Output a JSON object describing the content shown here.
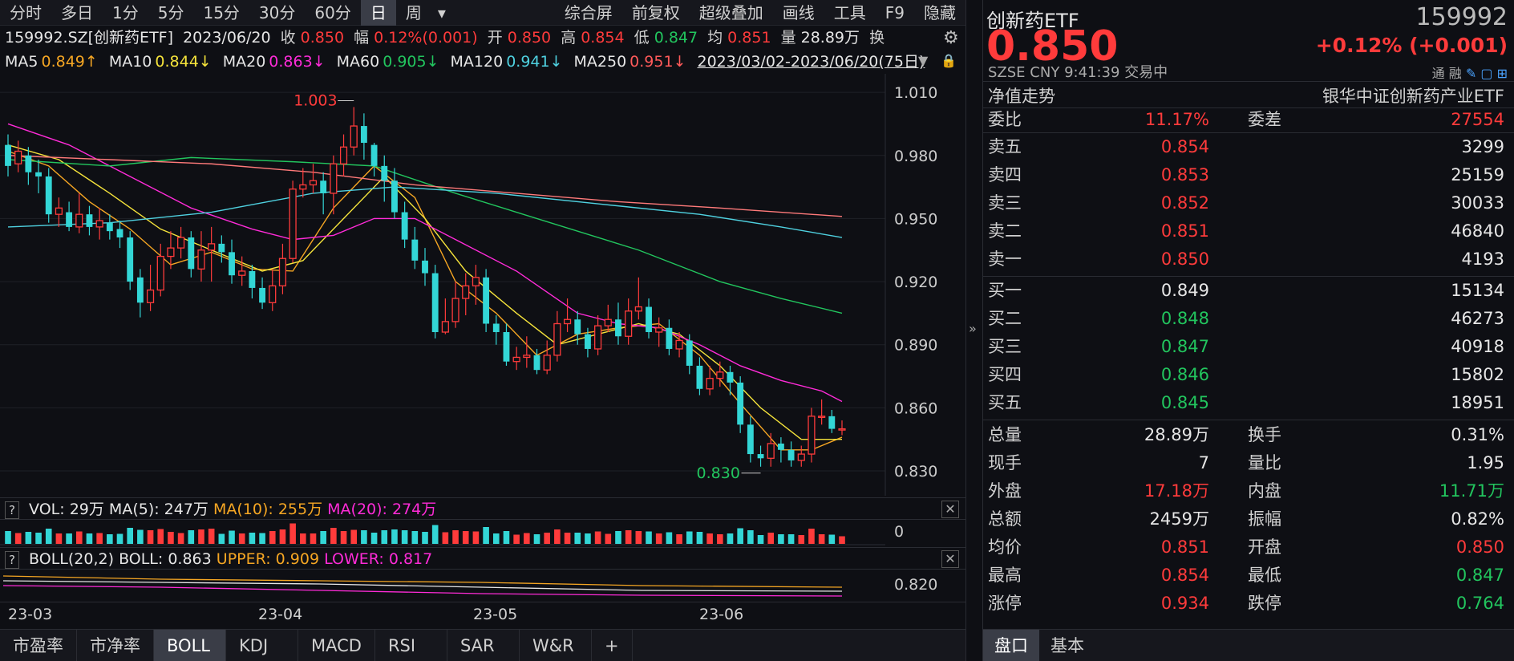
{
  "toolbar": {
    "left_items": [
      "分时",
      "多日",
      "1分",
      "5分",
      "15分",
      "30分",
      "60分",
      "日",
      "周"
    ],
    "active_index": 7,
    "dropdown_glyph": "▾",
    "right_items": [
      "综合屏",
      "前复权",
      "超级叠加",
      "画线",
      "工具",
      "F9",
      "隐藏"
    ]
  },
  "info": {
    "code": "159992.SZ[创新药ETF]",
    "date": "2023/06/20",
    "close_label": "收",
    "close": "0.850",
    "change_label": "幅",
    "change": "0.12%(0.001)",
    "open_label": "开",
    "open": "0.850",
    "high_label": "高",
    "high": "0.854",
    "low_label": "低",
    "low": "0.847",
    "avg_label": "均",
    "avg": "0.851",
    "volume_label": "量",
    "volume": "28.89万",
    "turnover_label": "换"
  },
  "ma": {
    "items": [
      {
        "label": "MA5",
        "value": "0.849↑",
        "color": "#f5a623"
      },
      {
        "label": "MA10",
        "value": "0.844↓",
        "color": "#f5e33b"
      },
      {
        "label": "MA20",
        "value": "0.863↓",
        "color": "#ff2bd8"
      },
      {
        "label": "MA60",
        "value": "0.905↓",
        "color": "#22c55e"
      },
      {
        "label": "MA120",
        "value": "0.941↓",
        "color": "#4fd1e0"
      },
      {
        "label": "MA250",
        "value": "0.951↓",
        "color": "#ff5a5a"
      }
    ],
    "range": "2023/03/02-2023/06/20(75日)"
  },
  "chart": {
    "y_ticks": [
      "1.010",
      "0.980",
      "0.950",
      "0.920",
      "0.890",
      "0.860",
      "0.830"
    ],
    "max_label": "1.003",
    "min_label": "0.830",
    "x_ticks": [
      "23-03",
      "23-04",
      "23-05",
      "23-06"
    ]
  },
  "vol": {
    "title": "VOL: 29万",
    "ma5": "MA(5): 247万",
    "ma10": "MA(10): 255万",
    "ma20": "MA(20): 274万",
    "axis": "0"
  },
  "boll": {
    "title": "BOLL(20,2)",
    "boll": "BOLL: 0.863",
    "upper": "UPPER: 0.909",
    "lower": "LOWER: 0.817",
    "axis": "0.820"
  },
  "bottom_tabs": [
    "市盈率",
    "市净率",
    "BOLL",
    "KDJ",
    "MACD",
    "RSI",
    "SAR",
    "W&R",
    "+"
  ],
  "bottom_active": 2,
  "quote": {
    "name": "创新药ETF",
    "code": "159992",
    "price": "0.850",
    "change": "+0.12% (+0.001)",
    "exchange": "SZSE",
    "currency": "CNY",
    "time": "9:41:39",
    "status": "交易中",
    "icon_labels": [
      "通",
      "融"
    ],
    "nav_label": "净值走势",
    "index_name": "银华中证创新药产业ETF",
    "weibi_label": "委比",
    "weibi": "11.17%",
    "weicha_label": "委差",
    "weicha": "27554",
    "asks": [
      {
        "label": "卖五",
        "price": "0.854",
        "vol": "3299"
      },
      {
        "label": "卖四",
        "price": "0.853",
        "vol": "25159"
      },
      {
        "label": "卖三",
        "price": "0.852",
        "vol": "30033"
      },
      {
        "label": "卖二",
        "price": "0.851",
        "vol": "46840"
      },
      {
        "label": "卖一",
        "price": "0.850",
        "vol": "4193"
      }
    ],
    "bids": [
      {
        "label": "买一",
        "price": "0.849",
        "vol": "15134"
      },
      {
        "label": "买二",
        "price": "0.848",
        "vol": "46273"
      },
      {
        "label": "买三",
        "price": "0.847",
        "vol": "40918"
      },
      {
        "label": "买四",
        "price": "0.846",
        "vol": "15802"
      },
      {
        "label": "买五",
        "price": "0.845",
        "vol": "18951"
      }
    ],
    "stats": [
      {
        "l1": "总量",
        "v1": "28.89万",
        "l2": "换手",
        "v2": "0.31%"
      },
      {
        "l1": "现手",
        "v1": "7",
        "l2": "量比",
        "v2": "1.95"
      },
      {
        "l1": "外盘",
        "v1": "17.18万",
        "l2": "内盘",
        "v2": "11.71万"
      },
      {
        "l1": "总额",
        "v1": "2459万",
        "l2": "振幅",
        "v2": "0.82%"
      },
      {
        "l1": "均价",
        "v1": "0.851",
        "l2": "开盘",
        "v2": "0.850"
      },
      {
        "l1": "最高",
        "v1": "0.854",
        "l2": "最低",
        "v2": "0.847"
      },
      {
        "l1": "涨停",
        "v1": "0.934",
        "l2": "跌停",
        "v2": "0.764"
      }
    ],
    "tabs": [
      "盘口",
      "基本"
    ]
  },
  "chart_data": {
    "type": "candlestick",
    "ylim": [
      0.822,
      1.015
    ],
    "candles": [
      [
        0.985,
        0.975,
        0.99,
        0.97
      ],
      [
        0.976,
        0.982,
        0.987,
        0.972
      ],
      [
        0.98,
        0.972,
        0.984,
        0.966
      ],
      [
        0.972,
        0.97,
        0.978,
        0.962
      ],
      [
        0.97,
        0.952,
        0.974,
        0.948
      ],
      [
        0.952,
        0.955,
        0.96,
        0.946
      ],
      [
        0.953,
        0.946,
        0.958,
        0.944
      ],
      [
        0.946,
        0.952,
        0.962,
        0.943
      ],
      [
        0.952,
        0.946,
        0.956,
        0.942
      ],
      [
        0.946,
        0.949,
        0.955,
        0.94
      ],
      [
        0.948,
        0.944,
        0.952,
        0.94
      ],
      [
        0.945,
        0.941,
        0.949,
        0.936
      ],
      [
        0.941,
        0.92,
        0.944,
        0.916
      ],
      [
        0.922,
        0.91,
        0.926,
        0.903
      ],
      [
        0.91,
        0.916,
        0.928,
        0.906
      ],
      [
        0.916,
        0.932,
        0.938,
        0.913
      ],
      [
        0.932,
        0.936,
        0.944,
        0.926
      ],
      [
        0.936,
        0.941,
        0.946,
        0.931
      ],
      [
        0.941,
        0.926,
        0.944,
        0.922
      ],
      [
        0.926,
        0.935,
        0.944,
        0.92
      ],
      [
        0.935,
        0.938,
        0.946,
        0.92
      ],
      [
        0.938,
        0.934,
        0.942,
        0.929
      ],
      [
        0.934,
        0.923,
        0.94,
        0.919
      ],
      [
        0.923,
        0.925,
        0.932,
        0.918
      ],
      [
        0.925,
        0.917,
        0.928,
        0.912
      ],
      [
        0.917,
        0.91,
        0.922,
        0.907
      ],
      [
        0.91,
        0.918,
        0.926,
        0.906
      ],
      [
        0.918,
        0.931,
        0.938,
        0.914
      ],
      [
        0.931,
        0.964,
        0.968,
        0.929
      ],
      [
        0.964,
        0.966,
        0.974,
        0.96
      ],
      [
        0.966,
        0.968,
        0.976,
        0.962
      ],
      [
        0.968,
        0.962,
        0.972,
        0.952
      ],
      [
        0.962,
        0.976,
        0.98,
        0.952
      ],
      [
        0.976,
        0.984,
        0.99,
        0.97
      ],
      [
        0.984,
        0.994,
        1.003,
        0.98
      ],
      [
        0.994,
        0.986,
        1.0,
        0.978
      ],
      [
        0.985,
        0.975,
        0.986,
        0.97
      ],
      [
        0.975,
        0.968,
        0.98,
        0.958
      ],
      [
        0.968,
        0.953,
        0.974,
        0.95
      ],
      [
        0.953,
        0.94,
        0.958,
        0.936
      ],
      [
        0.94,
        0.93,
        0.946,
        0.926
      ],
      [
        0.93,
        0.924,
        0.936,
        0.918
      ],
      [
        0.924,
        0.896,
        0.928,
        0.893
      ],
      [
        0.896,
        0.901,
        0.912,
        0.895
      ],
      [
        0.901,
        0.912,
        0.92,
        0.898
      ],
      [
        0.912,
        0.918,
        0.924,
        0.904
      ],
      [
        0.918,
        0.922,
        0.928,
        0.909
      ],
      [
        0.922,
        0.9,
        0.926,
        0.896
      ],
      [
        0.9,
        0.896,
        0.904,
        0.89
      ],
      [
        0.896,
        0.882,
        0.9,
        0.88
      ],
      [
        0.882,
        0.884,
        0.889,
        0.878
      ],
      [
        0.884,
        0.885,
        0.894,
        0.879
      ],
      [
        0.885,
        0.878,
        0.888,
        0.876
      ],
      [
        0.878,
        0.885,
        0.892,
        0.876
      ],
      [
        0.885,
        0.9,
        0.906,
        0.882
      ],
      [
        0.9,
        0.902,
        0.912,
        0.896
      ],
      [
        0.902,
        0.895,
        0.906,
        0.89
      ],
      [
        0.895,
        0.888,
        0.898,
        0.884
      ],
      [
        0.888,
        0.899,
        0.904,
        0.885
      ],
      [
        0.899,
        0.902,
        0.909,
        0.896
      ],
      [
        0.902,
        0.894,
        0.91,
        0.89
      ],
      [
        0.894,
        0.906,
        0.912,
        0.89
      ],
      [
        0.906,
        0.908,
        0.922,
        0.902
      ],
      [
        0.908,
        0.896,
        0.912,
        0.893
      ],
      [
        0.896,
        0.898,
        0.903,
        0.889
      ],
      [
        0.898,
        0.888,
        0.902,
        0.885
      ],
      [
        0.888,
        0.892,
        0.896,
        0.884
      ],
      [
        0.892,
        0.88,
        0.895,
        0.876
      ],
      [
        0.88,
        0.869,
        0.884,
        0.866
      ],
      [
        0.869,
        0.874,
        0.88,
        0.866
      ],
      [
        0.874,
        0.877,
        0.882,
        0.87
      ],
      [
        0.877,
        0.872,
        0.88,
        0.866
      ],
      [
        0.872,
        0.852,
        0.875,
        0.848
      ],
      [
        0.852,
        0.838,
        0.856,
        0.834
      ],
      [
        0.838,
        0.836,
        0.842,
        0.832
      ],
      [
        0.836,
        0.843,
        0.848,
        0.832
      ],
      [
        0.843,
        0.84,
        0.846,
        0.834
      ],
      [
        0.84,
        0.835,
        0.844,
        0.832
      ],
      [
        0.835,
        0.838,
        0.842,
        0.832
      ],
      [
        0.838,
        0.856,
        0.86,
        0.834
      ],
      [
        0.856,
        0.856,
        0.864,
        0.852
      ],
      [
        0.856,
        0.85,
        0.859,
        0.848
      ],
      [
        0.85,
        0.85,
        0.854,
        0.847
      ]
    ],
    "ma_lines": [
      {
        "name": "MA5",
        "color": "#f5a623",
        "points": [
          [
            0,
            0.982
          ],
          [
            4,
            0.975
          ],
          [
            8,
            0.958
          ],
          [
            12,
            0.945
          ],
          [
            16,
            0.928
          ],
          [
            20,
            0.934
          ],
          [
            24,
            0.926
          ],
          [
            28,
            0.925
          ],
          [
            32,
            0.955
          ],
          [
            36,
            0.975
          ],
          [
            40,
            0.96
          ],
          [
            44,
            0.92
          ],
          [
            48,
            0.905
          ],
          [
            52,
            0.885
          ],
          [
            56,
            0.895
          ],
          [
            60,
            0.898
          ],
          [
            64,
            0.9
          ],
          [
            68,
            0.885
          ],
          [
            72,
            0.862
          ],
          [
            76,
            0.84
          ],
          [
            79,
            0.84
          ],
          [
            82,
            0.846
          ]
        ]
      },
      {
        "name": "MA10",
        "color": "#f5e33b",
        "points": [
          [
            0,
            0.985
          ],
          [
            5,
            0.978
          ],
          [
            10,
            0.962
          ],
          [
            15,
            0.945
          ],
          [
            20,
            0.935
          ],
          [
            25,
            0.925
          ],
          [
            29,
            0.93
          ],
          [
            33,
            0.95
          ],
          [
            37,
            0.97
          ],
          [
            41,
            0.95
          ],
          [
            45,
            0.925
          ],
          [
            50,
            0.905
          ],
          [
            54,
            0.89
          ],
          [
            58,
            0.895
          ],
          [
            62,
            0.9
          ],
          [
            66,
            0.895
          ],
          [
            70,
            0.88
          ],
          [
            74,
            0.86
          ],
          [
            78,
            0.845
          ],
          [
            82,
            0.845
          ]
        ]
      },
      {
        "name": "MA20",
        "color": "#ff2bd8",
        "points": [
          [
            0,
            0.995
          ],
          [
            6,
            0.985
          ],
          [
            12,
            0.97
          ],
          [
            18,
            0.955
          ],
          [
            24,
            0.945
          ],
          [
            28,
            0.94
          ],
          [
            32,
            0.942
          ],
          [
            36,
            0.95
          ],
          [
            40,
            0.95
          ],
          [
            44,
            0.94
          ],
          [
            50,
            0.925
          ],
          [
            56,
            0.905
          ],
          [
            60,
            0.9
          ],
          [
            64,
            0.898
          ],
          [
            68,
            0.89
          ],
          [
            72,
            0.88
          ],
          [
            76,
            0.873
          ],
          [
            80,
            0.868
          ],
          [
            82,
            0.863
          ]
        ]
      },
      {
        "name": "MA60",
        "color": "#22c55e",
        "points": [
          [
            0,
            0.978
          ],
          [
            10,
            0.975
          ],
          [
            18,
            0.979
          ],
          [
            28,
            0.977
          ],
          [
            36,
            0.975
          ],
          [
            44,
            0.962
          ],
          [
            54,
            0.947
          ],
          [
            62,
            0.935
          ],
          [
            70,
            0.92
          ],
          [
            76,
            0.912
          ],
          [
            82,
            0.905
          ]
        ]
      },
      {
        "name": "MA120",
        "color": "#4fd1e0",
        "points": [
          [
            0,
            0.946
          ],
          [
            10,
            0.948
          ],
          [
            20,
            0.953
          ],
          [
            30,
            0.962
          ],
          [
            38,
            0.965
          ],
          [
            48,
            0.962
          ],
          [
            58,
            0.957
          ],
          [
            68,
            0.952
          ],
          [
            76,
            0.946
          ],
          [
            82,
            0.941
          ]
        ]
      },
      {
        "name": "MA250",
        "color": "#ff7a7a",
        "points": [
          [
            0,
            0.98
          ],
          [
            10,
            0.978
          ],
          [
            20,
            0.976
          ],
          [
            30,
            0.972
          ],
          [
            40,
            0.966
          ],
          [
            50,
            0.962
          ],
          [
            60,
            0.958
          ],
          [
            70,
            0.955
          ],
          [
            82,
            0.951
          ]
        ]
      }
    ]
  }
}
